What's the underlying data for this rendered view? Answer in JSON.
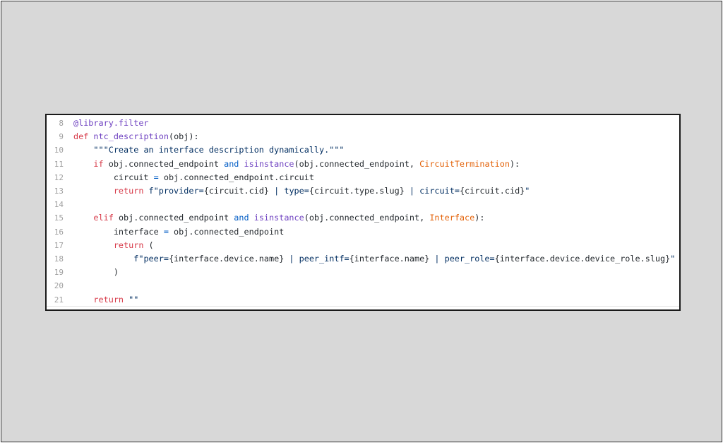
{
  "code_lines": [
    {
      "num": "8",
      "tokens": [
        {
          "t": "@library.filter",
          "c": "dec"
        }
      ]
    },
    {
      "num": "9",
      "tokens": [
        {
          "t": "def ",
          "c": "kw"
        },
        {
          "t": "ntc_description",
          "c": "fn"
        },
        {
          "t": "(obj):",
          "c": ""
        }
      ]
    },
    {
      "num": "10",
      "tokens": [
        {
          "t": "    ",
          "c": ""
        },
        {
          "t": "\"\"\"Create an interface description dynamically.\"\"\"",
          "c": "str"
        }
      ]
    },
    {
      "num": "11",
      "tokens": [
        {
          "t": "    ",
          "c": ""
        },
        {
          "t": "if ",
          "c": "kw"
        },
        {
          "t": "obj.connected_endpoint ",
          "c": ""
        },
        {
          "t": "and ",
          "c": "bi"
        },
        {
          "t": "isinstance",
          "c": "fn"
        },
        {
          "t": "(obj.connected_endpoint, ",
          "c": ""
        },
        {
          "t": "CircuitTermination",
          "c": "cls"
        },
        {
          "t": "):",
          "c": ""
        }
      ]
    },
    {
      "num": "12",
      "tokens": [
        {
          "t": "        circuit ",
          "c": ""
        },
        {
          "t": "=",
          "c": "bi"
        },
        {
          "t": " obj.connected_endpoint.circuit",
          "c": ""
        }
      ]
    },
    {
      "num": "13",
      "tokens": [
        {
          "t": "        ",
          "c": ""
        },
        {
          "t": "return ",
          "c": "kw"
        },
        {
          "t": "f\"provider=",
          "c": "str"
        },
        {
          "t": "{circuit.cid}",
          "c": ""
        },
        {
          "t": " | type=",
          "c": "str"
        },
        {
          "t": "{circuit.type.slug}",
          "c": ""
        },
        {
          "t": " | circuit=",
          "c": "str"
        },
        {
          "t": "{circuit.cid}",
          "c": ""
        },
        {
          "t": "\"",
          "c": "str"
        }
      ]
    },
    {
      "num": "14",
      "tokens": []
    },
    {
      "num": "15",
      "tokens": [
        {
          "t": "    ",
          "c": ""
        },
        {
          "t": "elif ",
          "c": "kw"
        },
        {
          "t": "obj.connected_endpoint ",
          "c": ""
        },
        {
          "t": "and ",
          "c": "bi"
        },
        {
          "t": "isinstance",
          "c": "fn"
        },
        {
          "t": "(obj.connected_endpoint, ",
          "c": ""
        },
        {
          "t": "Interface",
          "c": "cls"
        },
        {
          "t": "):",
          "c": ""
        }
      ]
    },
    {
      "num": "16",
      "tokens": [
        {
          "t": "        interface ",
          "c": ""
        },
        {
          "t": "=",
          "c": "bi"
        },
        {
          "t": " obj.connected_endpoint",
          "c": ""
        }
      ]
    },
    {
      "num": "17",
      "tokens": [
        {
          "t": "        ",
          "c": ""
        },
        {
          "t": "return ",
          "c": "kw"
        },
        {
          "t": "(",
          "c": ""
        }
      ]
    },
    {
      "num": "18",
      "tokens": [
        {
          "t": "            ",
          "c": ""
        },
        {
          "t": "f\"peer=",
          "c": "str"
        },
        {
          "t": "{interface.device.name}",
          "c": ""
        },
        {
          "t": " | peer_intf=",
          "c": "str"
        },
        {
          "t": "{interface.name}",
          "c": ""
        },
        {
          "t": " | peer_role=",
          "c": "str"
        },
        {
          "t": "{interface.device.device_role.slug}",
          "c": ""
        },
        {
          "t": "\"",
          "c": "str"
        }
      ]
    },
    {
      "num": "19",
      "tokens": [
        {
          "t": "        )",
          "c": ""
        }
      ]
    },
    {
      "num": "20",
      "tokens": []
    },
    {
      "num": "21",
      "tokens": [
        {
          "t": "    ",
          "c": ""
        },
        {
          "t": "return ",
          "c": "kw"
        },
        {
          "t": "\"\"",
          "c": "str"
        }
      ]
    }
  ]
}
